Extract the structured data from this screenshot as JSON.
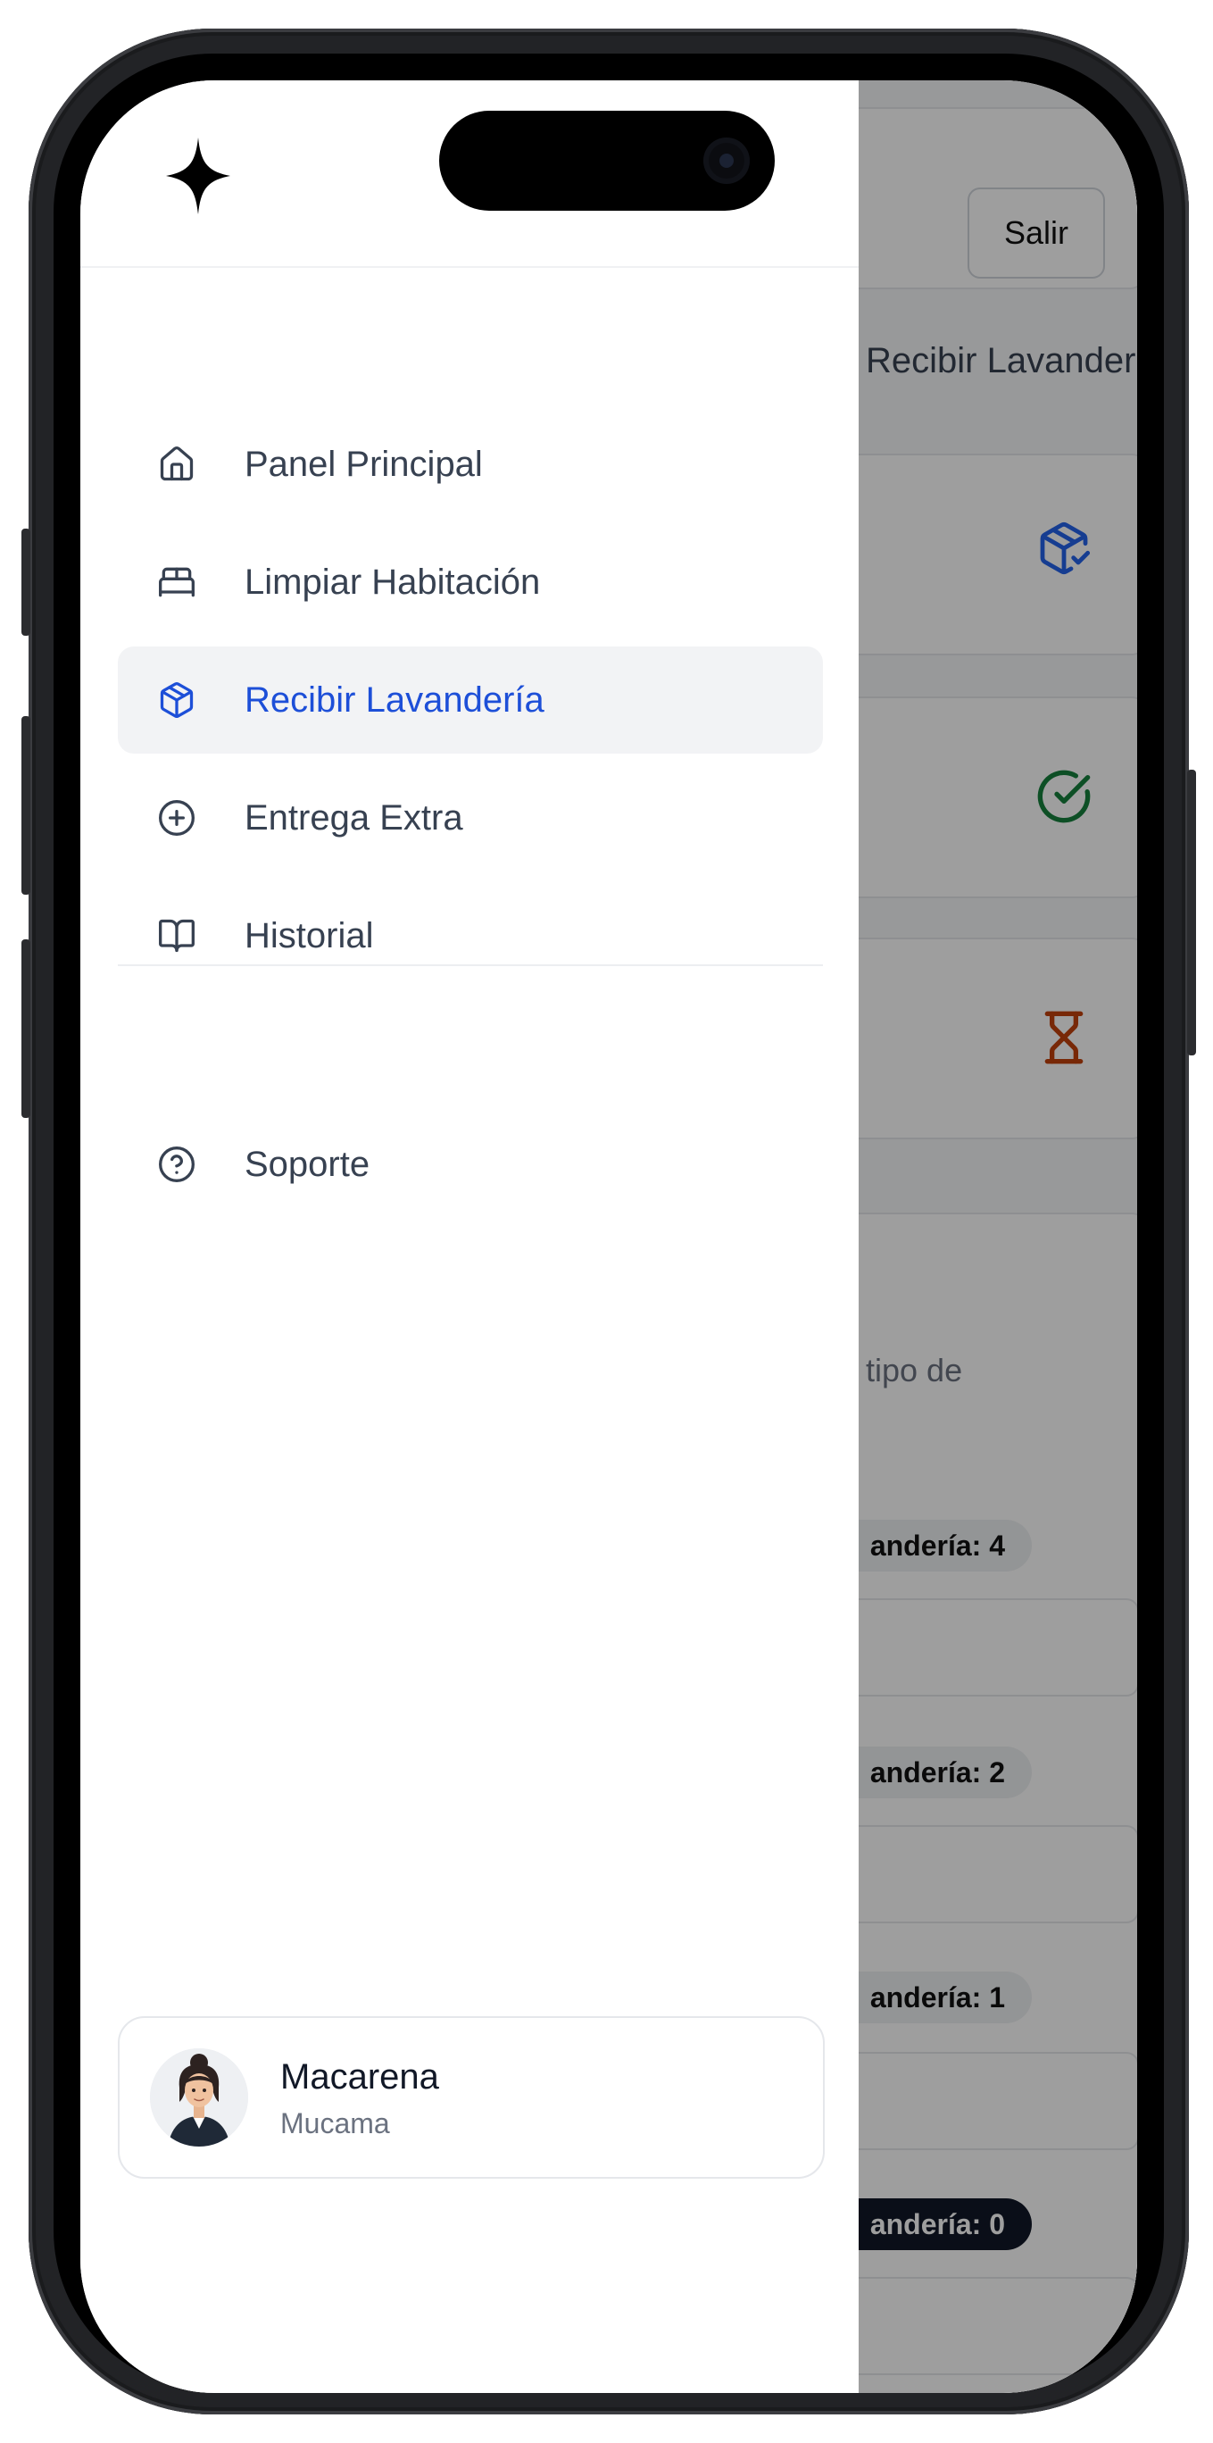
{
  "app": {
    "header": {
      "logout_label": "Salir"
    },
    "page_heading": "Recibir Lavandería",
    "stat_cards": [
      {
        "icon": "package-check-icon",
        "color": "#2563eb"
      },
      {
        "icon": "check-circle-icon",
        "color": "#15803d"
      },
      {
        "icon": "hourglass-icon",
        "color": "#c2410c"
      }
    ],
    "form": {
      "description_fragment": "tipo de",
      "pills": [
        {
          "label": "andería: 4",
          "dark": false
        },
        {
          "label": "andería: 2",
          "dark": false
        },
        {
          "label": "andería: 1",
          "dark": false
        },
        {
          "label": "andería: 0",
          "dark": true
        }
      ]
    }
  },
  "drawer": {
    "logo_icon": "sparkle-icon",
    "nav_items": [
      {
        "label": "Panel Principal",
        "icon": "home-icon",
        "active": false
      },
      {
        "label": "Limpiar Habitación",
        "icon": "bed-icon",
        "active": false
      },
      {
        "label": "Recibir Lavandería",
        "icon": "package-icon",
        "active": true
      },
      {
        "label": "Entrega Extra",
        "icon": "plus-circle-icon",
        "active": false
      },
      {
        "label": "Historial",
        "icon": "book-open-icon",
        "active": false
      }
    ],
    "support": {
      "label": "Soporte",
      "icon": "help-circle-icon"
    },
    "user": {
      "name": "Macarena",
      "role": "Mucama"
    }
  },
  "colors": {
    "active_text": "#1d4fd8",
    "active_bg": "#f2f3f5",
    "text": "#374151"
  }
}
